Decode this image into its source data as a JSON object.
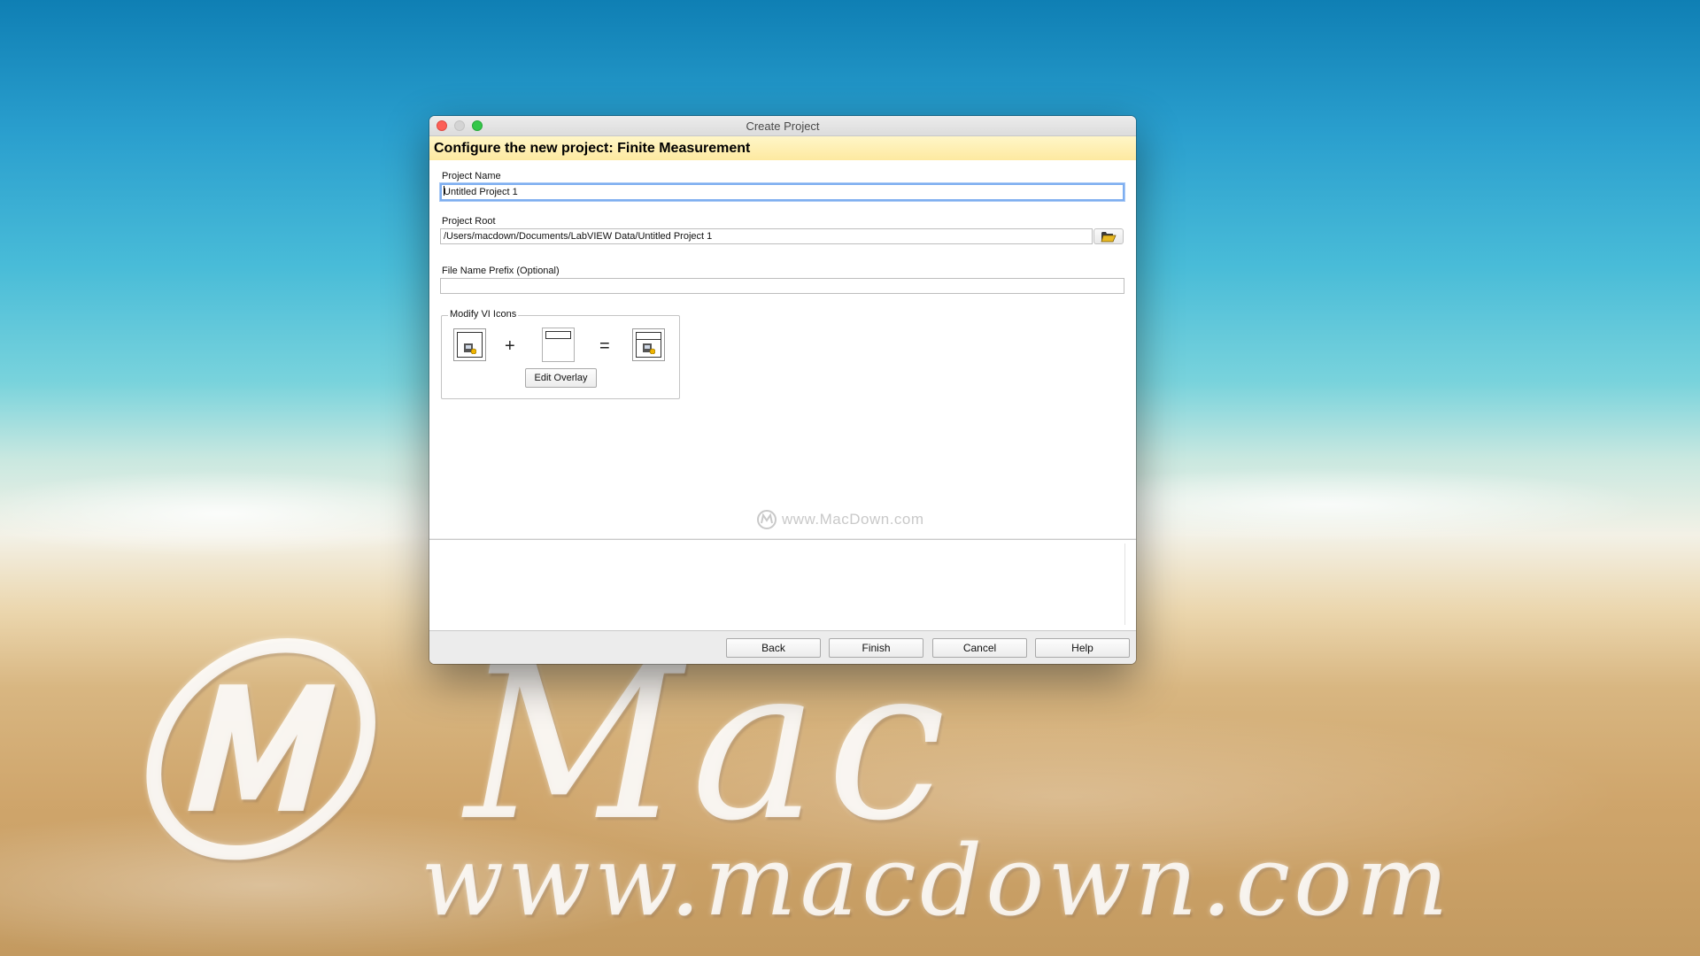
{
  "window": {
    "title": "Create Project",
    "banner": "Configure the new project: Finite Measurement"
  },
  "form": {
    "project_name_label": "Project Name",
    "project_name_value": "Untitled Project 1",
    "project_root_label": "Project Root",
    "project_root_value": "/Users/macdown/Documents/LabVIEW Data/Untitled Project 1",
    "prefix_label": "File Name Prefix (Optional)",
    "prefix_value": ""
  },
  "icons_group": {
    "label": "Modify VI Icons",
    "plus": "+",
    "equals": "=",
    "edit_overlay": "Edit Overlay"
  },
  "watermark": "www.MacDown.com",
  "footer": {
    "back": "Back",
    "finish": "Finish",
    "cancel": "Cancel",
    "help": "Help"
  },
  "background_art": {
    "mac": "Mac",
    "url": "www.macdown.com"
  },
  "colors": {
    "banner": "#fde9a0",
    "close": "#fc5f57",
    "zoom": "#33c748",
    "focus_ring": "#7eaef0"
  }
}
